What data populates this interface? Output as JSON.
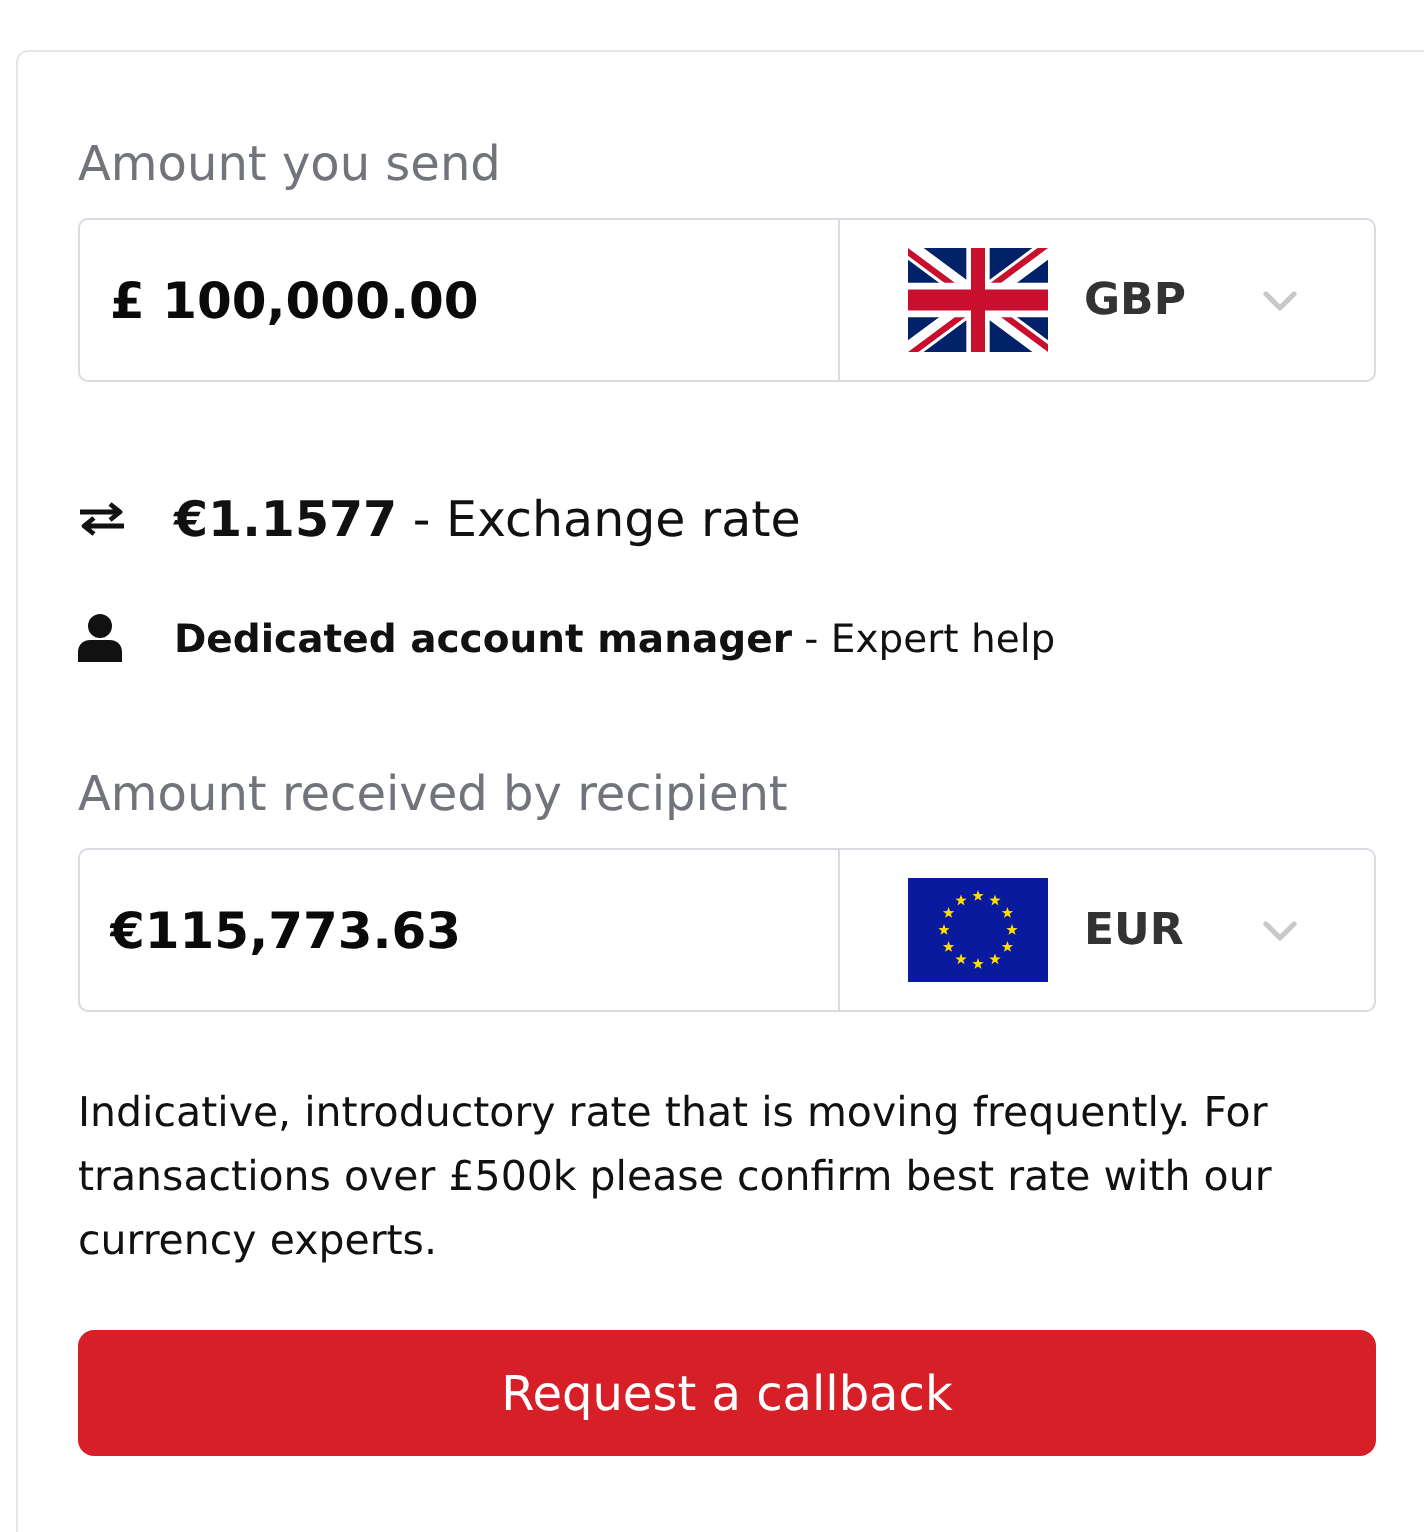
{
  "send": {
    "label": "Amount you send",
    "value": "£ 100,000.00",
    "currency": {
      "code": "GBP",
      "kind": "uk"
    }
  },
  "features": [
    {
      "kind": "rate",
      "text": "**€1.1577** - Exchange rate"
    },
    {
      "kind": "manager",
      "text": "**Dedicated account manager** - Expert help"
    }
  ],
  "receive": {
    "label": "Amount received by recipient",
    "value": "€115,773.63",
    "currency": {
      "code": "EUR",
      "kind": "eu"
    }
  },
  "disclaimer": "Indicative, introductory rate that is moving frequently. For transactions over £500k please confirm best rate with our currency experts.",
  "button": "Request a callback"
}
